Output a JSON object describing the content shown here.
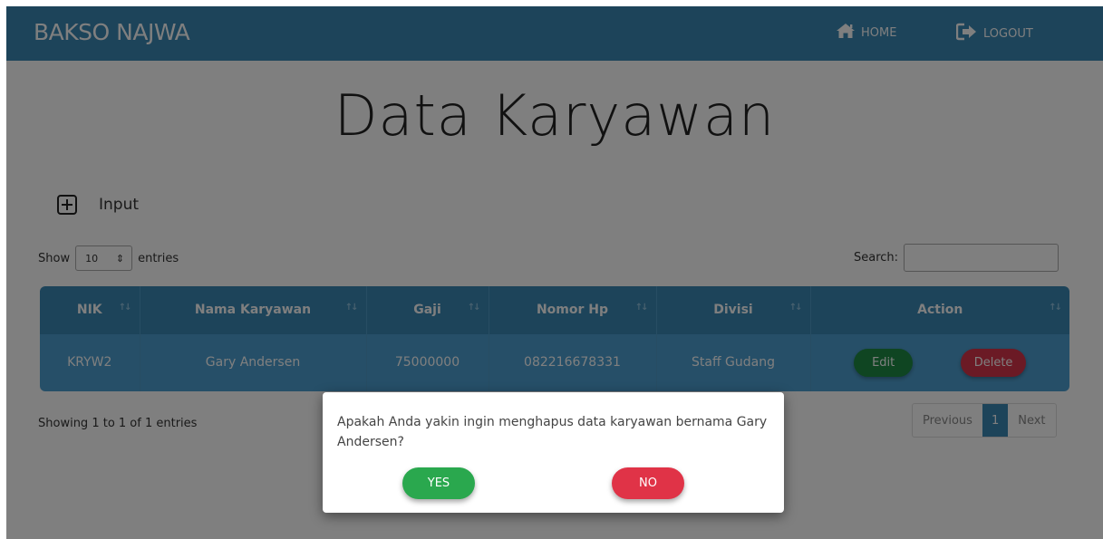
{
  "navbar": {
    "brand": "BAKSO NAJWA",
    "home_label": "HOME",
    "logout_label": "LOGOUT"
  },
  "page": {
    "title": "Data Karyawan",
    "input_label": "Input"
  },
  "length_control": {
    "show_label": "Show",
    "selected": "10",
    "entries_label": "entries"
  },
  "search": {
    "label": "Search:",
    "value": ""
  },
  "table": {
    "columns": [
      "NIK",
      "Nama Karyawan",
      "Gaji",
      "Nomor Hp",
      "Divisi",
      "Action"
    ],
    "rows": [
      {
        "nik": "KRYW2",
        "nama": "Gary Andersen",
        "gaji": "75000000",
        "nomor_hp": "082216678331",
        "divisi": "Staff Gudang",
        "edit_label": "Edit",
        "delete_label": "Delete"
      }
    ]
  },
  "footer": {
    "info": "Showing 1 to 1 of 1 entries",
    "previous": "Previous",
    "current_page": "1",
    "next": "Next"
  },
  "dialog": {
    "message": "Apakah Anda yakin ingin menghapus data karyawan bernama Gary Andersen?",
    "yes_label": "YES",
    "no_label": "NO"
  },
  "colors": {
    "primary": "#3b88b5",
    "row": "#4d9fd0",
    "success": "#2aa84e",
    "danger": "#e03347"
  }
}
